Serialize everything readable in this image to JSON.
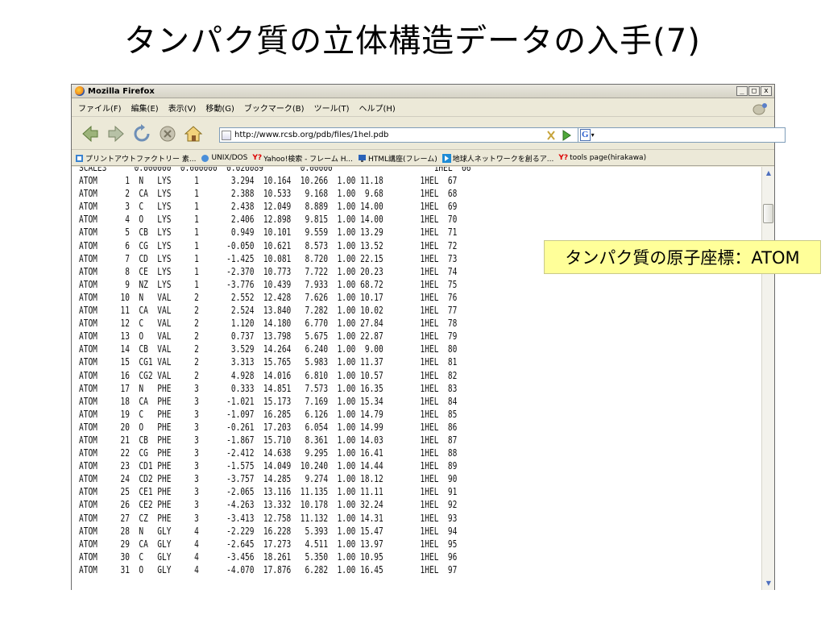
{
  "slide": {
    "title": "タンパク質の立体構造データの入手(7)",
    "callout": "タンパク質の原子座標：ATOM"
  },
  "window": {
    "title": "Mozilla Firefox",
    "controls": {
      "minimize": "_",
      "maximize": "□",
      "close": "x"
    }
  },
  "menu": [
    "ファイル(F)",
    "編集(E)",
    "表示(V)",
    "移動(G)",
    "ブックマーク(B)",
    "ツール(T)",
    "ヘルプ(H)"
  ],
  "navigation": {
    "url": "http://www.rcsb.org/pdb/files/1hel.pdb",
    "search_engine_label": "G"
  },
  "bookmarks": [
    "プリントアウトファクトリー 素...",
    "UNIX/DOS",
    "Yahoo!検索 - フレーム H...",
    "HTML講座(フレーム)",
    "地球人ネットワークを創るア...",
    "tools page(hirakawa)"
  ],
  "pdb_lines": [
    "SCALE3      0.000000  0.000000  0.026089        0.00000                      1HEL  66",
    "ATOM      1  N   LYS     1       3.294  10.164  10.266  1.00 11.18        1HEL  67",
    "ATOM      2  CA  LYS     1       2.388  10.533   9.168  1.00  9.68        1HEL  68",
    "ATOM      3  C   LYS     1       2.438  12.049   8.889  1.00 14.00        1HEL  69",
    "ATOM      4  O   LYS     1       2.406  12.898   9.815  1.00 14.00        1HEL  70",
    "ATOM      5  CB  LYS     1       0.949  10.101   9.559  1.00 13.29        1HEL  71",
    "ATOM      6  CG  LYS     1      -0.050  10.621   8.573  1.00 13.52        1HEL  72",
    "ATOM      7  CD  LYS     1      -1.425  10.081   8.720  1.00 22.15        1HEL  73",
    "ATOM      8  CE  LYS     1      -2.370  10.773   7.722  1.00 20.23        1HEL  74",
    "ATOM      9  NZ  LYS     1      -3.776  10.439   7.933  1.00 68.72        1HEL  75",
    "ATOM     10  N   VAL     2       2.552  12.428   7.626  1.00 10.17        1HEL  76",
    "ATOM     11  CA  VAL     2       2.524  13.840   7.282  1.00 10.02        1HEL  77",
    "ATOM     12  C   VAL     2       1.120  14.180   6.770  1.00 27.84        1HEL  78",
    "ATOM     13  O   VAL     2       0.737  13.798   5.675  1.00 22.87        1HEL  79",
    "ATOM     14  CB  VAL     2       3.529  14.264   6.240  1.00  9.00        1HEL  80",
    "ATOM     15  CG1 VAL     2       3.313  15.765   5.983  1.00 11.37        1HEL  81",
    "ATOM     16  CG2 VAL     2       4.928  14.016   6.810  1.00 10.57        1HEL  82",
    "ATOM     17  N   PHE     3       0.333  14.851   7.573  1.00 16.35        1HEL  83",
    "ATOM     18  CA  PHE     3      -1.021  15.173   7.169  1.00 15.34        1HEL  84",
    "ATOM     19  C   PHE     3      -1.097  16.285   6.126  1.00 14.79        1HEL  85",
    "ATOM     20  O   PHE     3      -0.261  17.203   6.054  1.00 14.99        1HEL  86",
    "ATOM     21  CB  PHE     3      -1.867  15.710   8.361  1.00 14.03        1HEL  87",
    "ATOM     22  CG  PHE     3      -2.412  14.638   9.295  1.00 16.41        1HEL  88",
    "ATOM     23  CD1 PHE     3      -1.575  14.049  10.240  1.00 14.44        1HEL  89",
    "ATOM     24  CD2 PHE     3      -3.757  14.285   9.274  1.00 18.12        1HEL  90",
    "ATOM     25  CE1 PHE     3      -2.065  13.116  11.135  1.00 11.11        1HEL  91",
    "ATOM     26  CE2 PHE     3      -4.263  13.332  10.178  1.00 32.24        1HEL  92",
    "ATOM     27  CZ  PHE     3      -3.413  12.758  11.132  1.00 14.31        1HEL  93",
    "ATOM     28  N   GLY     4      -2.229  16.228   5.393  1.00 15.47        1HEL  94",
    "ATOM     29  CA  GLY     4      -2.645  17.273   4.511  1.00 13.97        1HEL  95",
    "ATOM     30  C   GLY     4      -3.456  18.261   5.350  1.00 10.95        1HEL  96",
    "ATOM     31  O   GLY     4      -4.070  17.876   6.282  1.00 16.45        1HEL  97"
  ],
  "icons": {
    "back": "back-arrow-icon",
    "forward": "forward-arrow-icon",
    "reload": "reload-icon",
    "stop": "stop-icon",
    "home": "home-icon"
  }
}
